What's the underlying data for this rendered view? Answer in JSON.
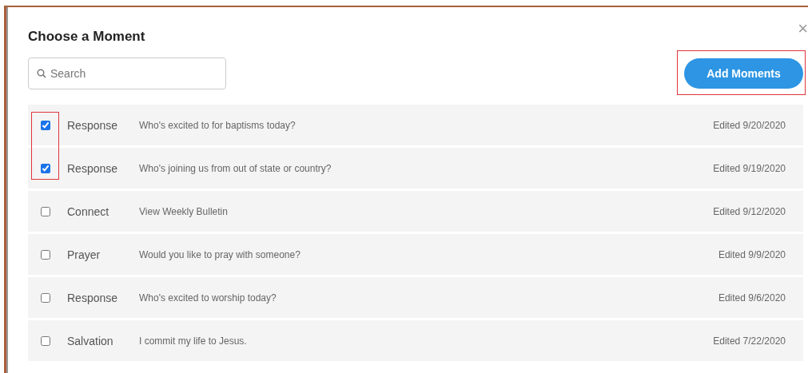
{
  "dialog": {
    "title": "Choose a Moment",
    "close": "×"
  },
  "search": {
    "placeholder": "Search"
  },
  "add_button": {
    "label": "Add Moments",
    "highlighted": true
  },
  "checkbox_highlight": true,
  "moments": [
    {
      "checked": true,
      "category": "Response",
      "text": "Who's excited to for baptisms today?",
      "edited": "Edited 9/20/2020"
    },
    {
      "checked": true,
      "category": "Response",
      "text": "Who's joining us from out of state or country?",
      "edited": "Edited 9/19/2020"
    },
    {
      "checked": false,
      "category": "Connect",
      "text": "View Weekly Bulletin",
      "edited": "Edited 9/12/2020"
    },
    {
      "checked": false,
      "category": "Prayer",
      "text": "Would you like to pray with someone?",
      "edited": "Edited 9/9/2020"
    },
    {
      "checked": false,
      "category": "Response",
      "text": "Who's excited to worship today?",
      "edited": "Edited 9/6/2020"
    },
    {
      "checked": false,
      "category": "Salvation",
      "text": "I commit my life to Jesus.",
      "edited": "Edited 7/22/2020"
    }
  ]
}
